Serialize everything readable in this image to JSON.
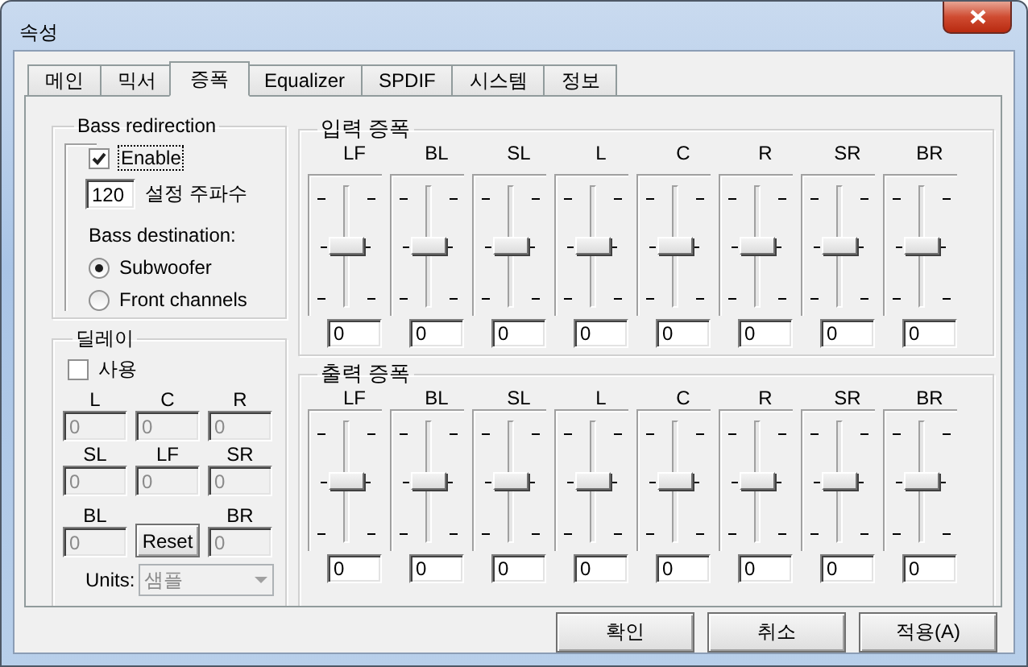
{
  "window": {
    "title": "속성"
  },
  "tabs": [
    {
      "label": "메인",
      "selected": false
    },
    {
      "label": "믹서",
      "selected": false
    },
    {
      "label": "증폭",
      "selected": true
    },
    {
      "label": "Equalizer",
      "selected": false
    },
    {
      "label": "SPDIF",
      "selected": false
    },
    {
      "label": "시스템",
      "selected": false
    },
    {
      "label": "정보",
      "selected": false
    }
  ],
  "bass_redirection": {
    "title": "Bass redirection",
    "enable": {
      "label": "Enable",
      "checked": true,
      "focused": true
    },
    "frequency": {
      "value": "120",
      "label": "설정 주파수"
    },
    "destination_label": "Bass destination:",
    "destinations": [
      {
        "label": "Subwoofer",
        "selected": true
      },
      {
        "label": "Front channels",
        "selected": false
      }
    ]
  },
  "delay": {
    "title": "딜레이",
    "enable": {
      "label": "사용",
      "checked": false
    },
    "channels": [
      {
        "label": "L",
        "value": "0"
      },
      {
        "label": "C",
        "value": "0"
      },
      {
        "label": "R",
        "value": "0"
      },
      {
        "label": "SL",
        "value": "0"
      },
      {
        "label": "LF",
        "value": "0"
      },
      {
        "label": "SR",
        "value": "0"
      },
      {
        "label": "BL",
        "value": "0"
      },
      {
        "label": "BR",
        "value": "0"
      }
    ],
    "reset_button": "Reset",
    "units": {
      "label": "Units:",
      "value": "샘플"
    }
  },
  "input_gain": {
    "title": "입력 증폭",
    "channels": [
      {
        "label": "LF",
        "level": 0.5,
        "value": "0"
      },
      {
        "label": "BL",
        "level": 0.5,
        "value": "0"
      },
      {
        "label": "SL",
        "level": 0.5,
        "value": "0"
      },
      {
        "label": "L",
        "level": 0.5,
        "value": "0"
      },
      {
        "label": "C",
        "level": 0.5,
        "value": "0"
      },
      {
        "label": "R",
        "level": 0.5,
        "value": "0"
      },
      {
        "label": "SR",
        "level": 0.5,
        "value": "0"
      },
      {
        "label": "BR",
        "level": 0.5,
        "value": "0"
      }
    ]
  },
  "output_gain": {
    "title": "출력 증폭",
    "channels": [
      {
        "label": "LF",
        "level": 0.5,
        "value": "0"
      },
      {
        "label": "BL",
        "level": 0.5,
        "value": "0"
      },
      {
        "label": "SL",
        "level": 0.5,
        "value": "0"
      },
      {
        "label": "L",
        "level": 0.5,
        "value": "0"
      },
      {
        "label": "C",
        "level": 0.5,
        "value": "0"
      },
      {
        "label": "R",
        "level": 0.5,
        "value": "0"
      },
      {
        "label": "SR",
        "level": 0.5,
        "value": "0"
      },
      {
        "label": "BR",
        "level": 0.5,
        "value": "0"
      }
    ]
  },
  "buttons": [
    {
      "label": "확인"
    },
    {
      "label": "취소"
    },
    {
      "label": "적용(A)"
    }
  ]
}
